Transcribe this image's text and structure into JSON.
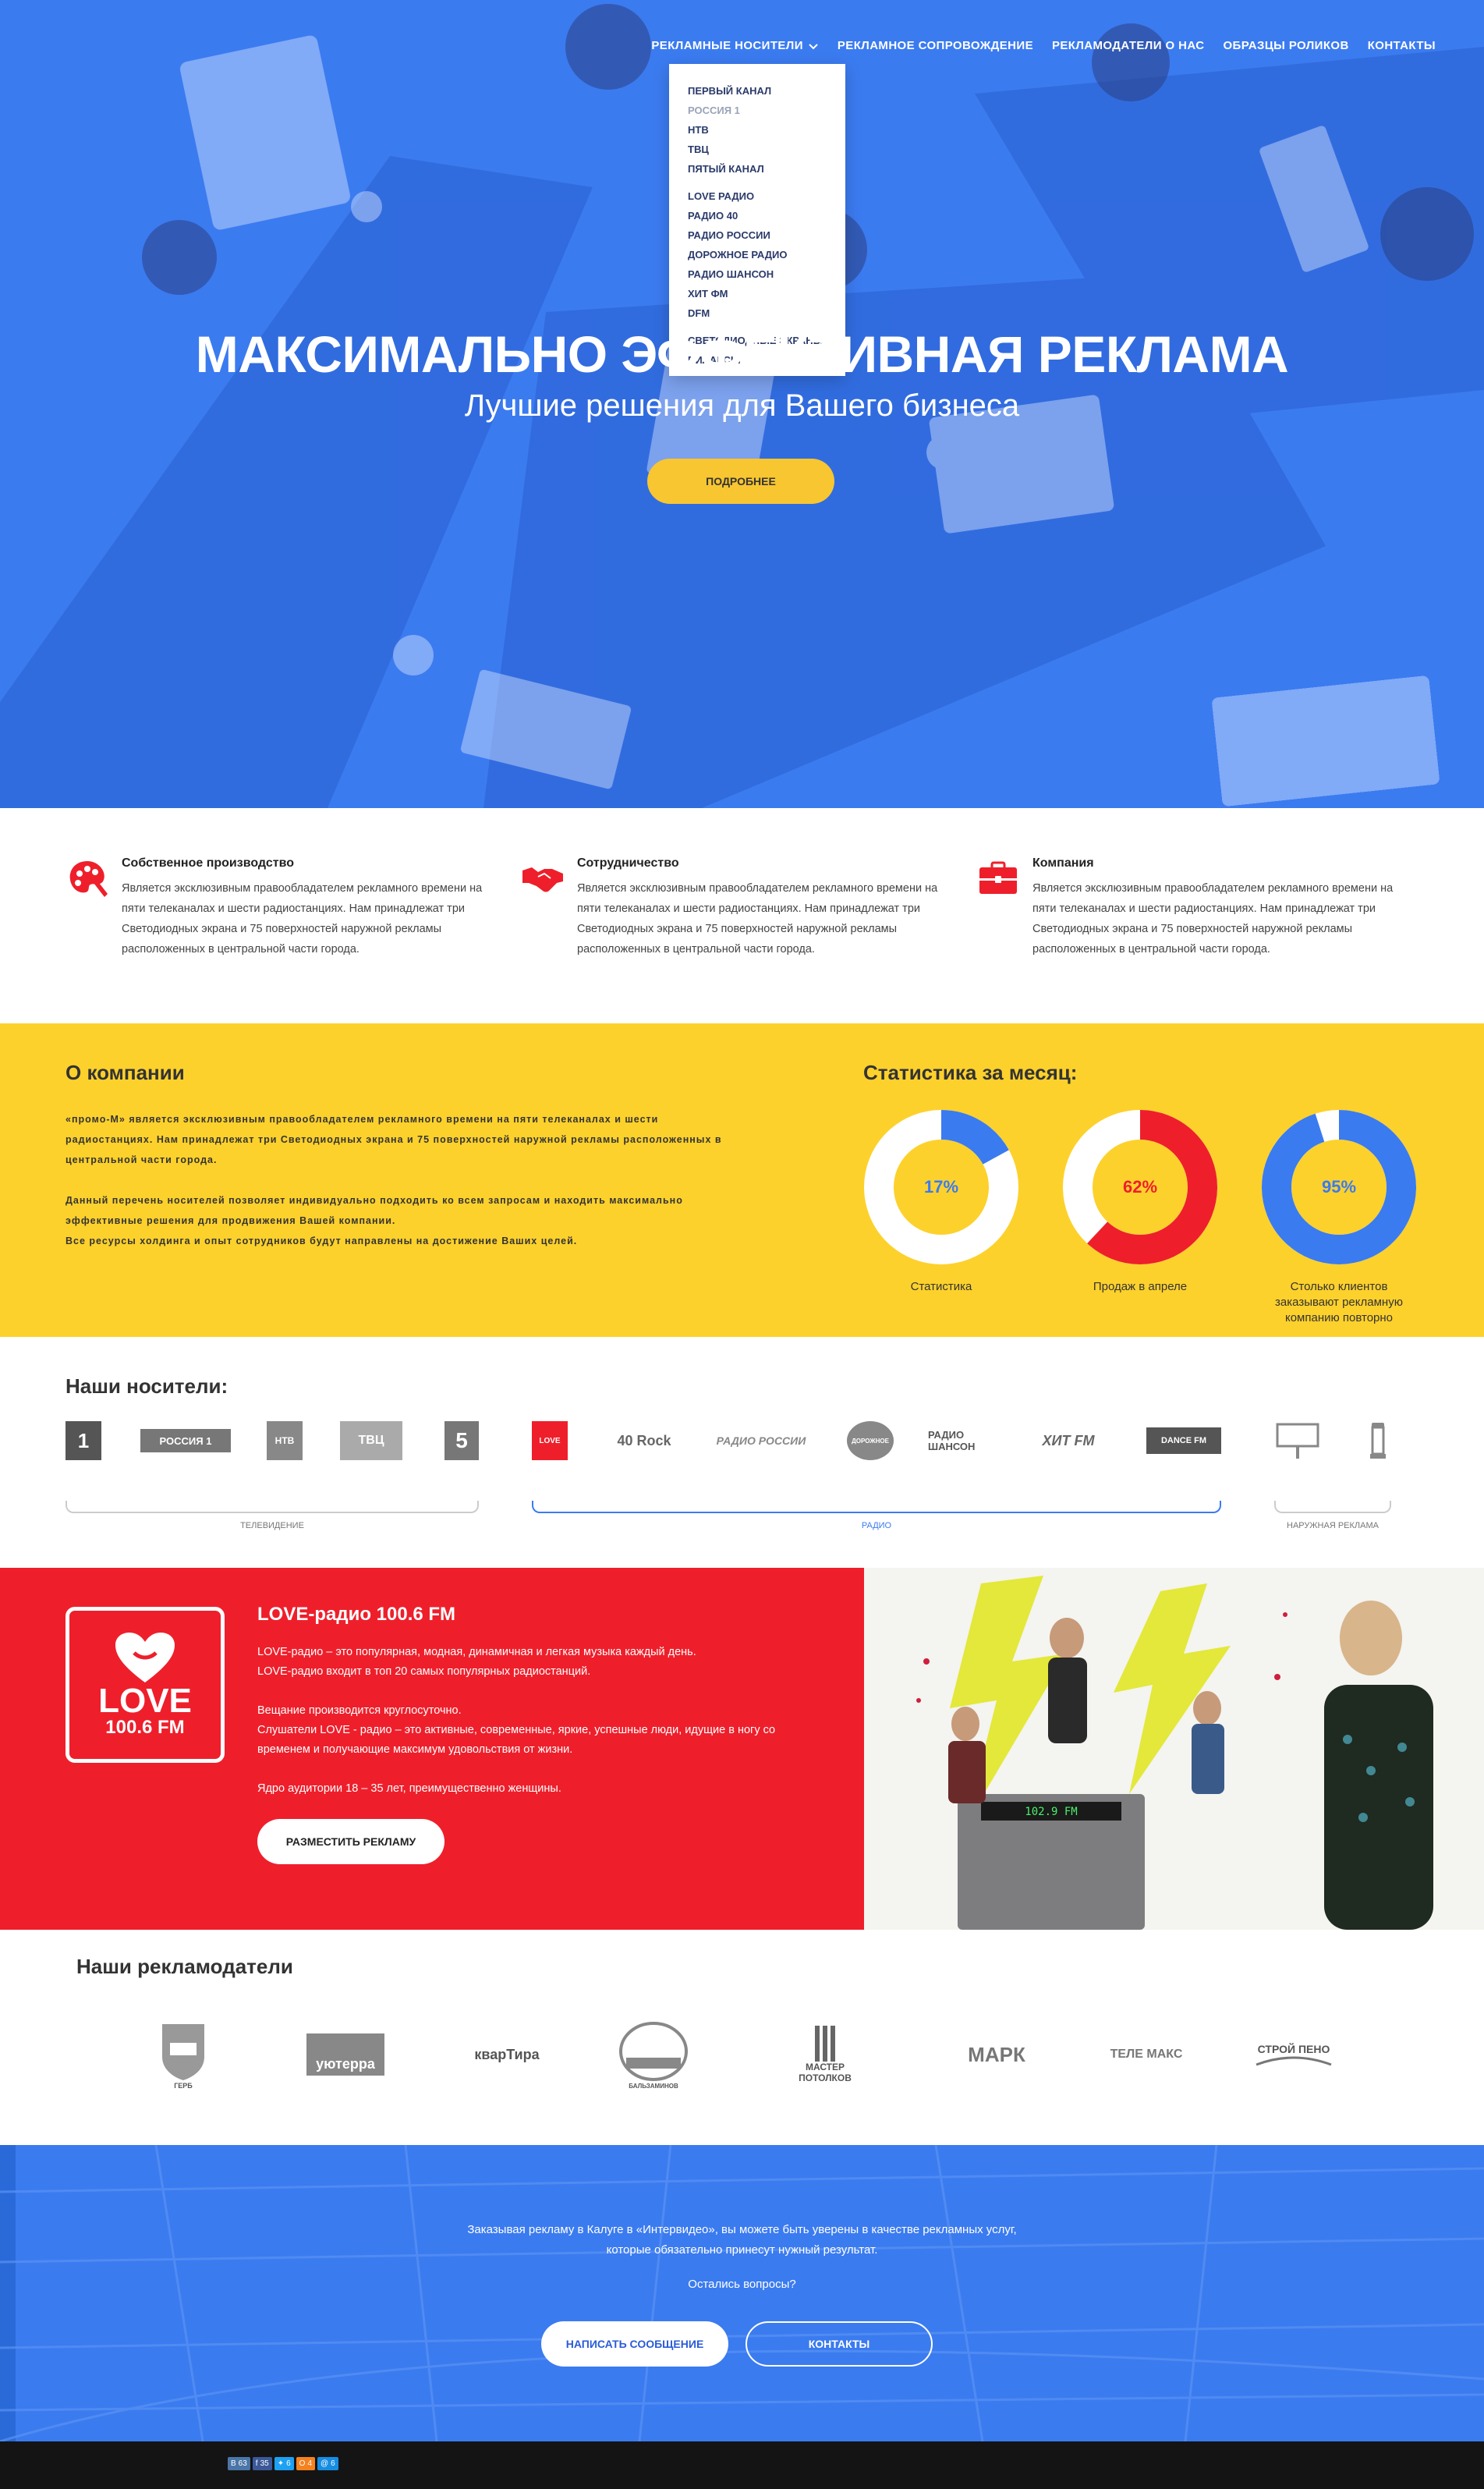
{
  "colors": {
    "blue": "#3b7bf0",
    "yellow": "#fdd12c",
    "red": "#ee1f2b",
    "button_yellow": "#f8c630"
  },
  "nav": {
    "items": [
      "Рекламные носители",
      "Рекламное сопровождение",
      "Рекламодатели о нас",
      "Образцы роликов",
      "Контакты"
    ]
  },
  "dropdown": {
    "tv": [
      "Первый канал",
      "Россия 1",
      "НТВ",
      "ТВЦ",
      "Пятый канал"
    ],
    "radio": [
      "LOVE радио",
      "Радио 40",
      "Радио России",
      "Дорожное радио",
      "Радио Шансон",
      "Хит ФМ",
      "DFM"
    ],
    "outdoor": [
      "Светодиодные экраны",
      "Пиларсы"
    ]
  },
  "hero": {
    "title": "Максимально эффективная реклама",
    "subtitle": "Лучшие решения для Вашего бизнеса",
    "button": "Подробнее"
  },
  "features": [
    {
      "icon": "palette-icon",
      "title": "Собственное производство",
      "text": "Является эксклюзивным правообладателем рекламного времени на пяти телеканалах и шести радиостанциях. Нам принадлежат три Светодиодных экрана и 75 поверхностей наружной рекламы  расположенных  в центральной части города."
    },
    {
      "icon": "handshake-icon",
      "title": "Сотрудничество",
      "text": "Является эксклюзивным правообладателем рекламного времени на пяти телеканалах и шести радиостанциях. Нам принадлежат три Светодиодных экрана и 75 поверхностей наружной рекламы  расположенных  в центральной части города."
    },
    {
      "icon": "briefcase-icon",
      "title": "Компания",
      "text": "Является эксклюзивным правообладателем рекламного времени на пяти телеканалах и шести радиостанциях.  Нам принадлежат три Светодиодных экрана и 75 поверхностей наружной рекламы  расположенных  в центральной части города."
    }
  ],
  "about": {
    "title": "О компании",
    "p1": "«промо-М» является эксклюзивным правообладателем рекламного времени на пяти телеканалах и шести радиостанциях.  Нам принадлежат три Светодиодных экрана и 75 поверхностей наружной рекламы расположенных  в центральной части города.",
    "p2": "Данный перечень носителей позволяет  индивидуально подходить ко всем запросам и находить максимально эффективные решения для продвижения Вашей компании.",
    "p3": "Все ресурсы холдинга и опыт сотрудников будут направлены на достижение Ваших целей."
  },
  "stats": {
    "title": "Статистика за месяц:",
    "items": [
      {
        "value": 17,
        "label": "17%",
        "caption": "Статистика",
        "color": "#3b7bf0"
      },
      {
        "value": 62,
        "label": "62%",
        "caption": "Продаж в апреле",
        "color": "#ee1f2b"
      },
      {
        "value": 95,
        "label": "95%",
        "caption": "Столько клиентов заказывают  рекламную компанию повторно",
        "color": "#3b7bf0"
      }
    ]
  },
  "media": {
    "title": "Наши носители:",
    "groups": [
      "Телевидение",
      "Радио",
      "Наружная реклама"
    ],
    "tv_logos": [
      "1",
      "РОССИЯ 1",
      "НТВ",
      "ТВЦ",
      "5"
    ],
    "radio_logos": [
      "LOVE",
      "40 Rock",
      "РАДИО РОССИИ",
      "ДОРОЖНОЕ",
      "РАДИО ШАНСОН",
      "ХИТ FM",
      "DANCE FM"
    ]
  },
  "love": {
    "logo_text": "LOVE",
    "logo_freq": "100.6 FM",
    "title": "LOVE-радио 100.6 FM",
    "lines": [
      "LOVE-радио – это популярная, модная, динамичная и легкая музыка каждый день.",
      "LOVE-радио входит в топ 20 самых популярных радиостанций.",
      "",
      "Вещание производится круглосуточно.",
      "Слушатели LOVE - радио – это активные, современные, яркие, успешные люди, идущие в ногу со временем и получающие максимум удовольствия от жизни.",
      "",
      "Ядро аудитории 18 – 35 лет, преимущественно женщины."
    ],
    "button": "Разместить рекламу",
    "freq_display": "102.9 FM"
  },
  "advertisers": {
    "title": "Наши рекламодатели",
    "logos": [
      "ГЕРБ",
      "уютерра",
      "кварТира",
      "БАЛЬЗАМИНОВ",
      "МАСТЕР ПОТОЛКОВ",
      "МАРК",
      "ТЕЛЕ МАКС",
      "СТРОЙ ПЕНО"
    ]
  },
  "cta": {
    "text1": "Заказывая рекламу в Калуге в «Интервидео», вы можете быть уверены в качестве рекламных услуг,",
    "text2": "которые обязательно принесут нужный результат.",
    "question": "Остались вопросы?",
    "button1": "Написать сообщение",
    "button2": "Контакты"
  },
  "share": [
    {
      "icon": "vk-icon",
      "count": "63",
      "color": "#4a76a8"
    },
    {
      "icon": "facebook-icon",
      "count": "35",
      "color": "#3b5998"
    },
    {
      "icon": "twitter-icon",
      "count": "6",
      "color": "#1da1f2"
    },
    {
      "icon": "odnoklassniki-icon",
      "count": "4",
      "color": "#f58220"
    },
    {
      "icon": "mail-icon",
      "count": "6",
      "color": "#168de2"
    }
  ]
}
